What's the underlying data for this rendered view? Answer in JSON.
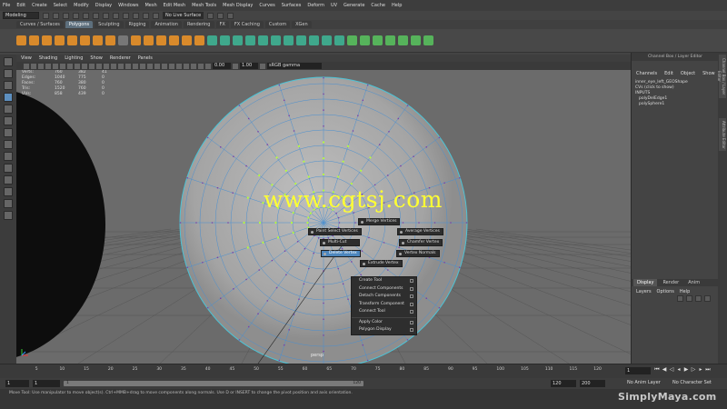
{
  "menubar": [
    "File",
    "Edit",
    "Create",
    "Select",
    "Modify",
    "Display",
    "Windows",
    "Mesh",
    "Edit Mesh",
    "Mesh Tools",
    "Mesh Display",
    "Curves",
    "Surfaces",
    "Deform",
    "UV",
    "Generate",
    "Cache",
    "Help"
  ],
  "statusline": {
    "mode": "Modeling",
    "live_surface": "No Live Surface"
  },
  "shelf_tabs": [
    "Curves / Surfaces",
    "Polygons",
    "Sculpting",
    "Rigging",
    "Animation",
    "Rendering",
    "FX",
    "FX Caching",
    "Custom",
    "XGen"
  ],
  "shelf_active": "Polygons",
  "panel_menu": [
    "View",
    "Shading",
    "Lighting",
    "Show",
    "Renderer",
    "Panels"
  ],
  "panel_toolbar": {
    "exposure": "0.00",
    "gamma_value": "1.00",
    "colorspace": "sRGB gamma"
  },
  "hud": {
    "rows": [
      {
        "label": "Verts:",
        "a": "760",
        "b": "382",
        "c": "41"
      },
      {
        "label": "Edges:",
        "a": "1040",
        "b": "775",
        "c": "0"
      },
      {
        "label": "Faces:",
        "a": "760",
        "b": "380",
        "c": "0"
      },
      {
        "label": "Tris:",
        "a": "1520",
        "b": "760",
        "c": "0"
      },
      {
        "label": "UVs:",
        "a": "858",
        "b": "439",
        "c": "0"
      }
    ]
  },
  "watermark": "www.cgtsj.com",
  "marking_menu": {
    "north": "Merge Vertices",
    "northwest": "Paint Select Vertices",
    "northeast": "Average Vertices",
    "center": "Multi-Cut",
    "east": "Chamfer Vertex",
    "southwest": "Delete Vertex",
    "southeast": "Vertex Normals",
    "south": "Extrude Vertex"
  },
  "submenu": [
    "Create Tool",
    "Connect Components",
    "Detach Components",
    "Transform Component",
    "Connect Tool",
    "Apply Color",
    "Polygon Display"
  ],
  "viewport_label": "persp",
  "right_panel": {
    "header": "Channel Box / Layer Editor",
    "menu": [
      "Channels",
      "Edit",
      "Object",
      "Show"
    ],
    "object_name": "inner_eye_left_GEOShape",
    "cvs": "CVs (click to show)",
    "inputs_label": "INPUTS",
    "inputs": [
      "polyDelEdge1",
      "polySphere1"
    ],
    "layer_tabs": [
      "Display",
      "Render",
      "Anim"
    ],
    "layer_menu": [
      "Layers",
      "Options",
      "Help"
    ]
  },
  "side_tabs": [
    "Channel Box / Layer Editor",
    "Attribute Editor"
  ],
  "time_slider": {
    "ticks": [
      "5",
      "10",
      "15",
      "20",
      "25",
      "30",
      "35",
      "40",
      "45",
      "50",
      "55",
      "60",
      "65",
      "70",
      "75",
      "80",
      "85",
      "90",
      "95",
      "100",
      "105",
      "110",
      "115",
      "120"
    ],
    "current_frame": "1"
  },
  "range_slider": {
    "start": "1",
    "start2": "1",
    "inner_start": "1",
    "inner_end": "120",
    "end1": "120",
    "end2": "200",
    "anim_layer": "No Anim Layer",
    "char_set": "No Character Set"
  },
  "help_line": "Move Tool: Use manipulator to move object(s). Ctrl+MMB+drag to move components along normals. Use D or INSERT to change the pivot position and axis orientation.",
  "branding": "SimplyMaya.com"
}
